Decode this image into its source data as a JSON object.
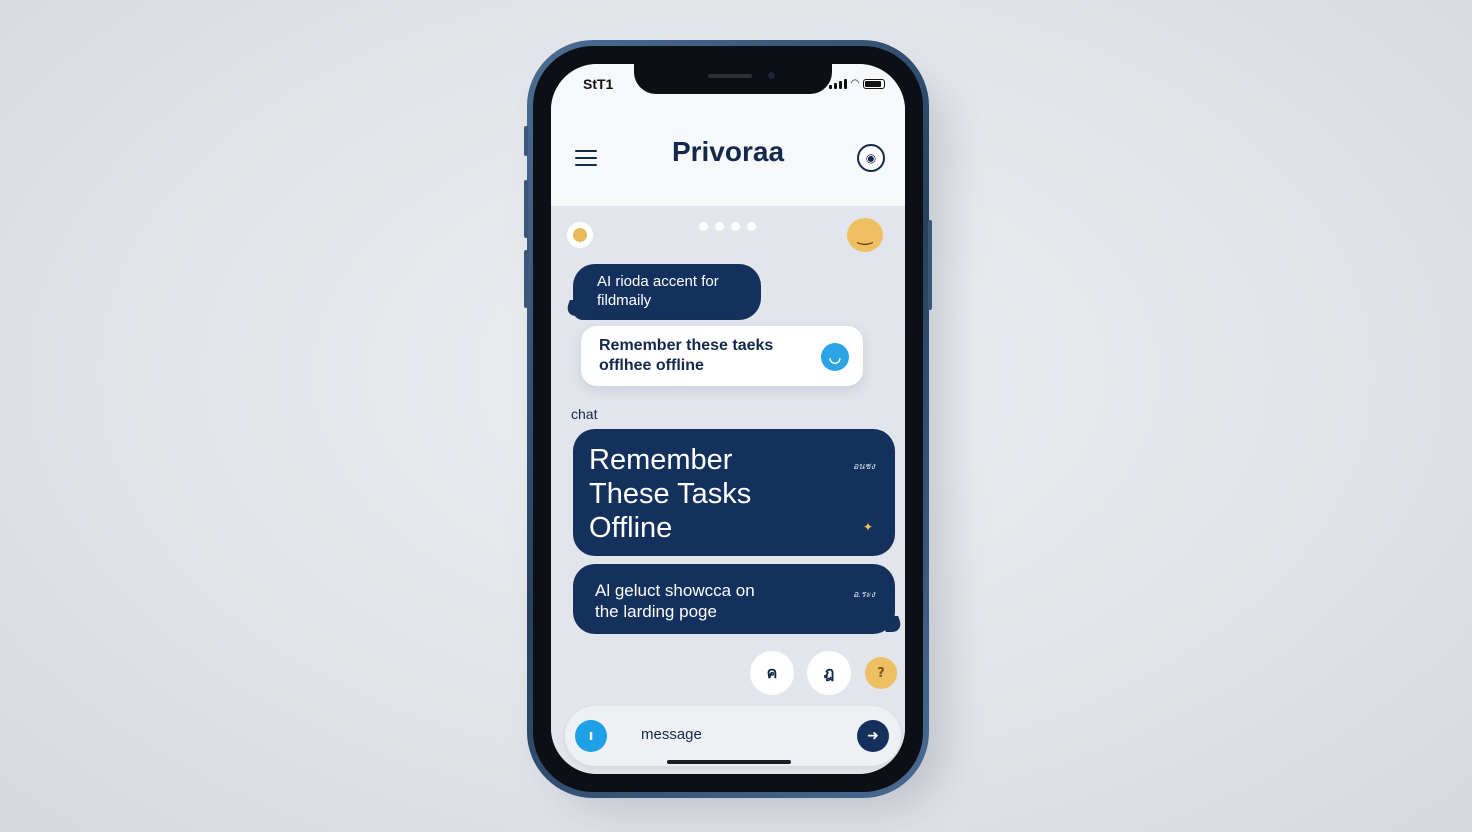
{
  "status_bar": {
    "time": "StT1"
  },
  "header": {
    "title": "Privoraa",
    "menu_icon": "hamburger-menu-icon",
    "profile_icon": "profile-badge-icon"
  },
  "chat": {
    "messages": [
      {
        "text_line1": "AI rioda accent for",
        "text_line2": "fildmaily"
      },
      {
        "text_line1": "Remember these taeks",
        "text_line2": "offlhee offline",
        "icon": "shield-icon"
      }
    ],
    "section_label": "chat",
    "hero": {
      "line1": "Remember",
      "line2": "These Tasks",
      "line3": "Offline",
      "tag": "อนชง"
    },
    "showcase": {
      "line1": "Al geluct showcca on",
      "line2": "the larding poge",
      "tag": "อ.ระง"
    }
  },
  "quick_actions": [
    "ค",
    "ฎ",
    "?"
  ],
  "composer": {
    "placeholder": "message",
    "mic_icon": "mic-icon",
    "send_icon": "send-icon"
  },
  "colors": {
    "accent": "#13315c",
    "bubble_text": "#ffffff",
    "highlight": "#1ea1e6",
    "emoji": "#efc061"
  }
}
